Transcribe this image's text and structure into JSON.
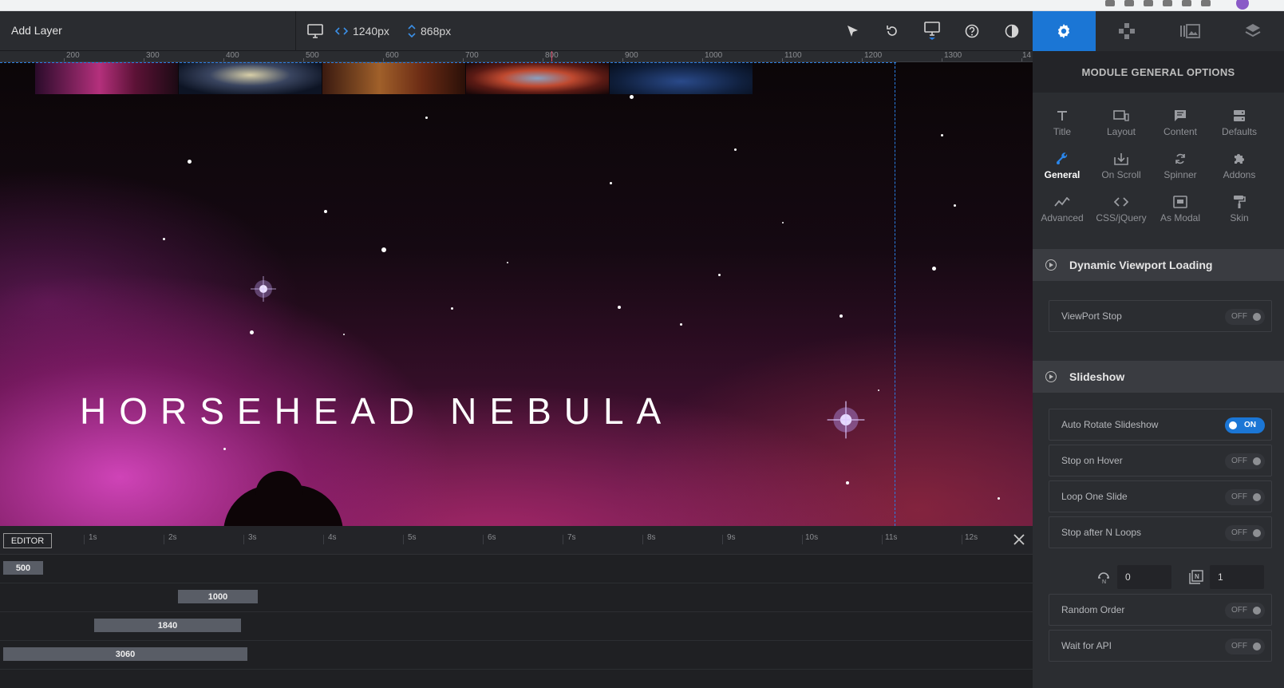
{
  "toolbar": {
    "add_layer_label": "Add Layer",
    "width_value": "1240px",
    "height_value": "868px"
  },
  "panel": {
    "title": "MODULE GENERAL OPTIONS",
    "tabs": [
      {
        "icon": "gear-icon",
        "active": true
      },
      {
        "icon": "gamepad-icon",
        "active": false
      },
      {
        "icon": "slides-icon",
        "active": false
      },
      {
        "icon": "layers-icon",
        "active": false
      }
    ],
    "options": [
      {
        "label": "Title",
        "icon": "title-icon"
      },
      {
        "label": "Layout",
        "icon": "layout-icon"
      },
      {
        "label": "Content",
        "icon": "content-icon"
      },
      {
        "label": "Defaults",
        "icon": "defaults-icon"
      },
      {
        "label": "General",
        "icon": "wrench-icon",
        "active": true
      },
      {
        "label": "On Scroll",
        "icon": "on-scroll-icon"
      },
      {
        "label": "Spinner",
        "icon": "spinner-icon"
      },
      {
        "label": "Addons",
        "icon": "puzzle-icon"
      },
      {
        "label": "Advanced",
        "icon": "advanced-icon"
      },
      {
        "label": "CSS/jQuery",
        "icon": "code-icon"
      },
      {
        "label": "As Modal",
        "icon": "modal-icon"
      },
      {
        "label": "Skin",
        "icon": "paint-roller-icon"
      }
    ],
    "sections": {
      "dynamic_viewport": {
        "title": "Dynamic Viewport Loading",
        "viewport_stop": {
          "label": "ViewPort Stop",
          "state": "OFF"
        }
      },
      "slideshow": {
        "title": "Slideshow",
        "auto_rotate": {
          "label": "Auto Rotate Slideshow",
          "state": "ON"
        },
        "stop_hover": {
          "label": "Stop on Hover",
          "state": "OFF"
        },
        "loop_one": {
          "label": "Loop One Slide",
          "state": "OFF"
        },
        "stop_after": {
          "label": "Stop after N Loops",
          "state": "OFF"
        },
        "loops_value": "0",
        "slide_value": "1",
        "random_order": {
          "label": "Random Order",
          "state": "OFF"
        },
        "wait_api": {
          "label": "Wait for API",
          "state": "OFF"
        }
      }
    }
  },
  "ruler": {
    "labels": [
      "200",
      "300",
      "400",
      "500",
      "600",
      "700",
      "800",
      "900",
      "1000",
      "1100",
      "1200",
      "1300",
      "14"
    ]
  },
  "canvas": {
    "headline": "HORSEHEAD NEBULA"
  },
  "timeline": {
    "editor_label": "EDITOR",
    "time_labels": [
      "1s",
      "2s",
      "3s",
      "4s",
      "5s",
      "6s",
      "7s",
      "8s",
      "9s",
      "10s",
      "11s",
      "12s"
    ],
    "tracks": [
      {
        "value": "500"
      },
      {
        "value": "1000"
      },
      {
        "value": "1840"
      },
      {
        "value": "3060"
      }
    ]
  },
  "colors": {
    "accent": "#1b76d5",
    "guide": "#2a7de1"
  }
}
